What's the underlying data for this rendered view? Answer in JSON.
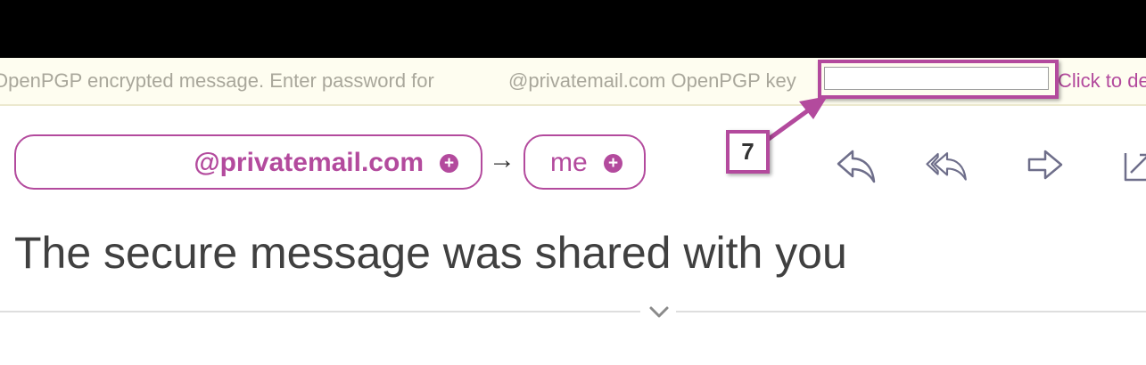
{
  "encryption_bar": {
    "text_before": "OpenPGP encrypted message. Enter password for",
    "text_after": "@privatemail.com OpenPGP key",
    "password_value": "",
    "password_placeholder": "",
    "decrypt_link": "Click to decrypt"
  },
  "annotation": {
    "step_number": "7",
    "color": "#b34a9d"
  },
  "header": {
    "from_address": "@privatemail.com",
    "arrow": "→",
    "to_address": "me",
    "plus_glyph": "+"
  },
  "actions": {
    "icons": [
      "reply-icon",
      "reply-all-icon",
      "forward-icon",
      "open-external-icon"
    ]
  },
  "subject": "The secure message was shared with you",
  "colors": {
    "accent": "#b34a9d",
    "banner_background": "#fefdf0",
    "banner_text": "#a9a79b",
    "subject_text": "#404040",
    "icon_stroke": "#6e6e8a"
  }
}
